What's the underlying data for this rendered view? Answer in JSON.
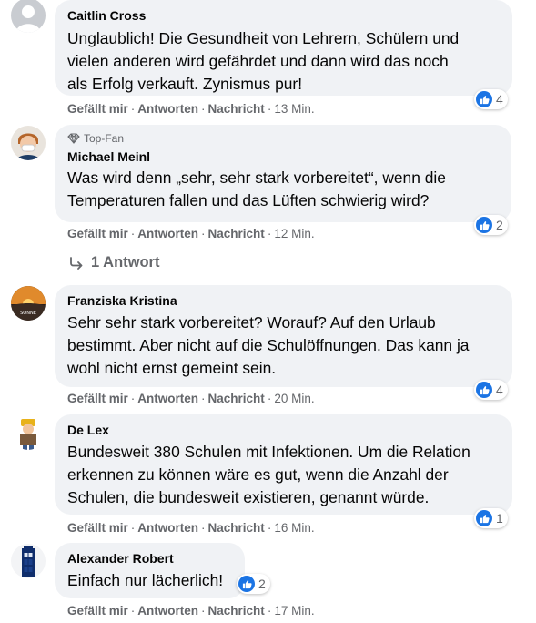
{
  "actions": {
    "like": "Gefällt mir",
    "reply": "Antworten",
    "message": "Nachricht",
    "sep": "·"
  },
  "comments": [
    {
      "author": "Caitlin Cross",
      "text": "Unglaublich! Die Gesundheit von Lehrern, Schülern und\nvielen anderen wird gefährdet und dann wird das noch\nals Erfolg verkauft. Zynismus pur!",
      "time": "13 Min.",
      "reactions": "4"
    },
    {
      "badge": "Top-Fan",
      "author": "Michael Meinl",
      "text": "Was wird denn „sehr, sehr stark vorbereitet“, wenn die\nTemperaturen fallen und das Lüften schwierig wird?",
      "time": "12 Min.",
      "reactions": "2",
      "replies": "1 Antwort"
    },
    {
      "author": "Franziska Kristina",
      "text": "Sehr sehr stark vorbereitet? Worauf? Auf den Urlaub\nbestimmt. Aber nicht auf die Schulöffnungen. Das kann ja\nwohl nicht ernst gemeint sein.",
      "time": "20 Min.",
      "reactions": "4"
    },
    {
      "author": "De Lex",
      "text": "Bundesweit 380 Schulen mit Infektionen. Um die Relation\nerkennen zu können wäre es gut, wenn die Anzahl der\nSchulen, die bundesweit existieren, genannt würde.",
      "time": "16 Min.",
      "reactions": "1"
    },
    {
      "author": "Alexander Robert",
      "text": "Einfach nur lächerlich!",
      "time": "17 Min.",
      "reactions": "2"
    }
  ],
  "colors": {
    "bubble": "#f0f2f5",
    "like_blue": "#1b74e4",
    "meta": "#65676b"
  }
}
